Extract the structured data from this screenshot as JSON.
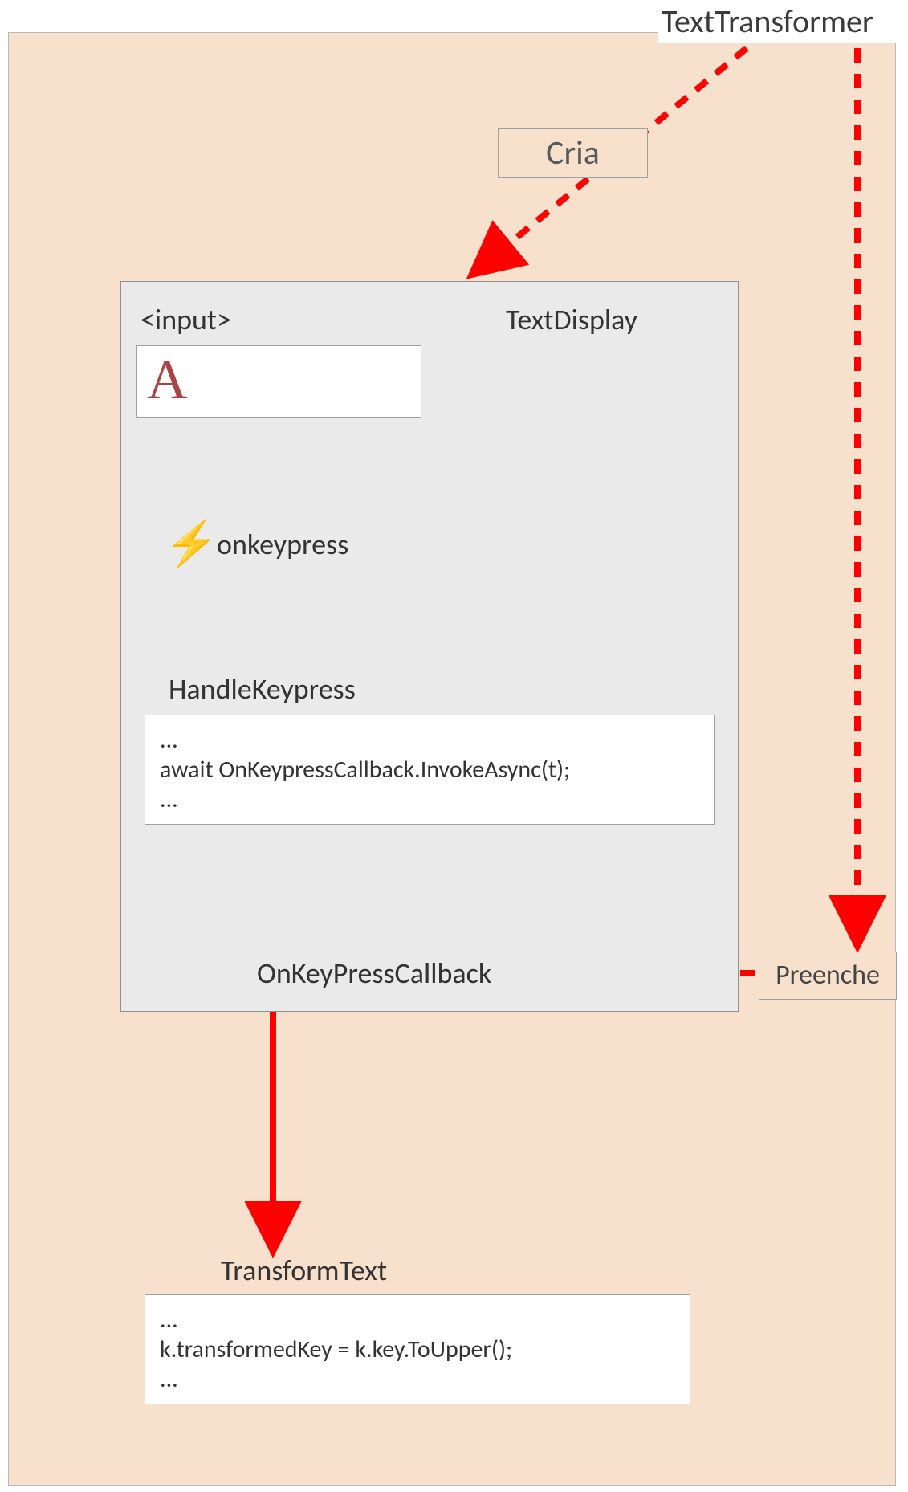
{
  "transformer_label": "TextTransformer",
  "cria_label": "Cria",
  "display_label": "TextDisplay",
  "input_tag_label": "<input>",
  "input_value": "A",
  "event_label": "onkeypress",
  "handle_label": "HandleKeypress",
  "handle_code": "...\nawait OnKeypressCallback.InvokeAsync(t);\n...",
  "callback_label": "OnKeyPressCallback",
  "preenche_label": "Preenche",
  "transform_label": "TransformText",
  "transform_code": "...\nk.transformedKey = k.key.ToUpper();\n..."
}
